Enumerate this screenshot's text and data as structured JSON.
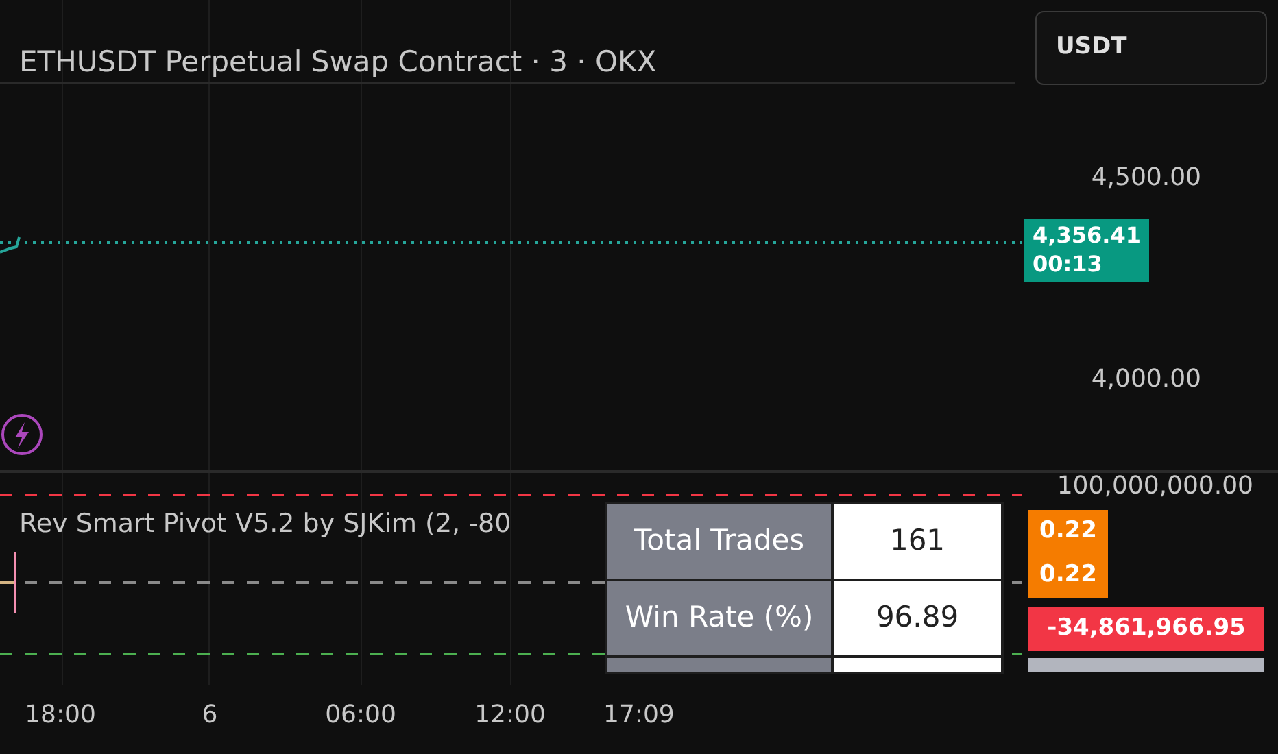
{
  "header": {
    "symbol_title": "ETHUSDT Perpetual Swap Contract · 3 · OKX",
    "currency_button": "USDT"
  },
  "price_axis": {
    "ticks": [
      "4,500.00",
      "4,000.00"
    ],
    "last_price": {
      "price": "4,356.41",
      "countdown": "00:13"
    }
  },
  "indicator_pane": {
    "title": "Rev Smart Pivot V5.2 by SJKim (2, -80",
    "axis_tick": "100,000,000.00",
    "labels": [
      {
        "text": "0.22",
        "color": "#f57c00"
      },
      {
        "text": "0.22",
        "color": "#f57c00"
      },
      {
        "text": "-34,861,966.95",
        "color": "#f23645"
      }
    ],
    "stats_table": [
      {
        "label": "Total Trades",
        "value": "161"
      },
      {
        "label": "Win Rate (%)",
        "value": "96.89"
      }
    ]
  },
  "time_axis": [
    "18:00",
    "6",
    "06:00",
    "12:00"
  ],
  "crosshair_time": "17:09"
}
